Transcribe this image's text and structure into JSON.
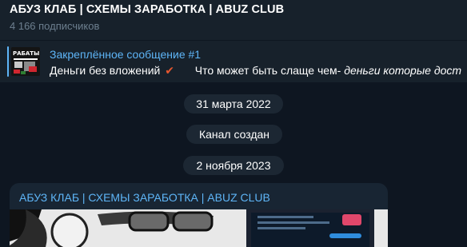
{
  "channel": {
    "title": "АБУЗ КЛАБ | СХЕМЫ ЗАРАБОТКА | ABUZ CLUB",
    "subscribers": "4 166 подписчиков"
  },
  "pinned": {
    "title": "Закреплённое сообщение #1",
    "preview_text": "Деньги без вложений",
    "preview_tail": "Что может быть слаще чем-",
    "preview_italic": "деньги которые дост",
    "thumb_caption": "РАБАТЫВАІ"
  },
  "dates": {
    "first": "31 марта 2022",
    "service": "Канал создан",
    "second": "2 ноября 2023"
  },
  "message": {
    "author": "АБУЗ КЛАБ | СХЕМЫ ЗАРАБОТКА | ABUZ CLUB"
  },
  "colors": {
    "accent": "#5eb5f7",
    "background": "#0e1621",
    "panel": "#17212b",
    "check": "#e5572f"
  }
}
